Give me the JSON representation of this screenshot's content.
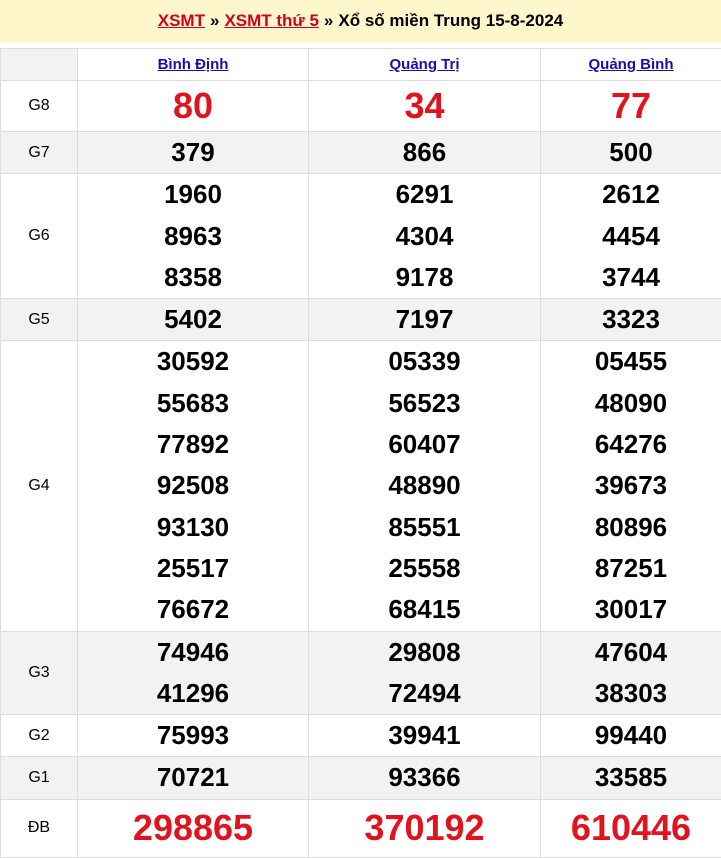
{
  "header": {
    "link1": "XSMT",
    "sep1": "»",
    "link2": "XSMT thứ 5",
    "sep2": "»",
    "title": "Xổ số miền Trung 15-8-2024"
  },
  "provinces": [
    "Bình Định",
    "Quảng Trị",
    "Quảng Bình"
  ],
  "prizes": [
    {
      "label": "G8",
      "values": [
        [
          "80"
        ],
        [
          "34"
        ],
        [
          "77"
        ]
      ]
    },
    {
      "label": "G7",
      "values": [
        [
          "379"
        ],
        [
          "866"
        ],
        [
          "500"
        ]
      ]
    },
    {
      "label": "G6",
      "values": [
        [
          "1960",
          "8963",
          "8358"
        ],
        [
          "6291",
          "4304",
          "9178"
        ],
        [
          "2612",
          "4454",
          "3744"
        ]
      ]
    },
    {
      "label": "G5",
      "values": [
        [
          "5402"
        ],
        [
          "7197"
        ],
        [
          "3323"
        ]
      ]
    },
    {
      "label": "G4",
      "values": [
        [
          "30592",
          "55683",
          "77892",
          "92508",
          "93130",
          "25517",
          "76672"
        ],
        [
          "05339",
          "56523",
          "60407",
          "48890",
          "85551",
          "25558",
          "68415"
        ],
        [
          "05455",
          "48090",
          "64276",
          "39673",
          "80896",
          "87251",
          "30017"
        ]
      ]
    },
    {
      "label": "G3",
      "values": [
        [
          "74946",
          "41296"
        ],
        [
          "29808",
          "72494"
        ],
        [
          "47604",
          "38303"
        ]
      ]
    },
    {
      "label": "G2",
      "values": [
        [
          "75993"
        ],
        [
          "39941"
        ],
        [
          "99440"
        ]
      ]
    },
    {
      "label": "G1",
      "values": [
        [
          "70721"
        ],
        [
          "93366"
        ],
        [
          "33585"
        ]
      ]
    },
    {
      "label": "ĐB",
      "values": [
        [
          "298865"
        ],
        [
          "370192"
        ],
        [
          "610446"
        ]
      ]
    }
  ],
  "colors": {
    "header_bg": "#fff7cc",
    "link_red": "#d0021b",
    "province_link": "#1a0dab",
    "highlight_red": "#e0141e",
    "alt_row": "#f2f2f2"
  }
}
